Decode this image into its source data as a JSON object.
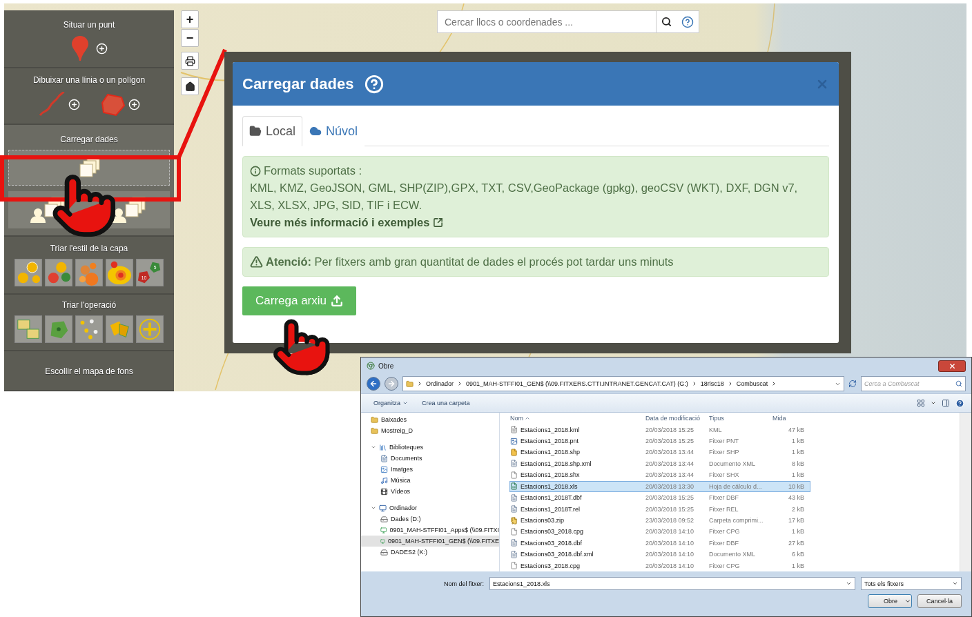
{
  "sidebar": {
    "sections": [
      {
        "kind": "point",
        "title": "Situar un punt"
      },
      {
        "kind": "draw",
        "title": "Dibuixar una línia o un polígon"
      },
      {
        "kind": "upload",
        "title": "Carregar dades"
      },
      {
        "kind": "styles",
        "title": "Triar l'estil de la capa",
        "cluster_counts": [
          "5",
          "10"
        ]
      },
      {
        "kind": "operations",
        "title": "Triar l'operació"
      },
      {
        "kind": "basemap",
        "title": "Escollir el mapa de fons"
      }
    ]
  },
  "map_controls": {
    "zoom_in": "+",
    "zoom_out": "−"
  },
  "search": {
    "placeholder": "Cercar llocs o coordenades ..."
  },
  "modal": {
    "title": "Carregar dades",
    "tabs": [
      {
        "kind": "local",
        "label": "Local",
        "selected": true
      },
      {
        "kind": "cloud",
        "label": "Núvol",
        "selected": false
      }
    ],
    "formats_title": "Formats suportats :",
    "formats": "KML, KMZ, GeoJSON, GML, SHP(ZIP),GPX, TXT, CSV,GeoPackage (gpkg), geoCSV (WKT), DXF, DGN v7, XLS, XLSX, JPG, SID, TIF i ECW.",
    "more_link": "Veure més informació i exemples",
    "warning": "**Atenció:** Per fitxers amb gran quantitat de dades el procés pot tardar uns minuts",
    "upload_button": "Carrega arxiu"
  },
  "file_dialog": {
    "title": "Obre",
    "path": [
      "Ordinador",
      "0901_MAH-STFFI01_GEN$ (\\\\09.FITXERS.CTTI.INTRANET.GENCAT.CAT) (G:)",
      "18risc18",
      "Combuscat"
    ],
    "search_placeholder": "Cerca a Combuscat",
    "toolbar": [
      "Organitza",
      "Crea una carpeta"
    ],
    "nav": [
      {
        "kind": "folder",
        "label": "Baixades",
        "selected": false
      },
      {
        "kind": "folder",
        "label": "Mostreig_D",
        "selected": false
      },
      {
        "kind": "library",
        "label": "Biblioteques",
        "selected": false,
        "expanded": true,
        "children": [
          {
            "kind": "doc",
            "label": "Documents",
            "selected": false
          },
          {
            "kind": "image",
            "label": "Imatges",
            "selected": false
          },
          {
            "kind": "music",
            "label": "Música",
            "selected": false
          },
          {
            "kind": "video",
            "label": "Vídeos",
            "selected": false
          }
        ]
      },
      {
        "kind": "computer",
        "label": "Ordinador",
        "selected": false,
        "expanded": true,
        "children": [
          {
            "kind": "drive",
            "label": "Dades (D:)",
            "selected": false
          },
          {
            "kind": "network",
            "label": "0901_MAH-STFFI01_Apps$ (\\\\09.FITXI",
            "selected": false
          },
          {
            "kind": "network",
            "label": "0901_MAH-STFFI01_GEN$ (\\\\09.FITXE",
            "selected": true
          },
          {
            "kind": "drive",
            "label": "DADES2 (K:)",
            "selected": false
          }
        ]
      }
    ],
    "columns": [
      "Nom",
      "Data de modificació",
      "Tipus",
      "Mida"
    ],
    "rows": [
      {
        "kind": "doc",
        "name": "Estacions1_2018.kml",
        "date": "20/03/2018 15:25",
        "type": "KML",
        "size": "47 kB",
        "selected": false
      },
      {
        "kind": "image",
        "name": "Estacions1_2018.pnt",
        "date": "20/03/2018 15:25",
        "type": "Fitxer PNT",
        "size": "1 kB",
        "selected": false
      },
      {
        "kind": "shape",
        "name": "Estacions1_2018.shp",
        "date": "20/03/2018 13:44",
        "type": "Fitxer SHP",
        "size": "1 kB",
        "selected": false
      },
      {
        "kind": "text",
        "name": "Estacions1_2018.shp.xml",
        "date": "20/03/2018 13:44",
        "type": "Documento XML",
        "size": "8 kB",
        "selected": false
      },
      {
        "kind": "blank",
        "name": "Estacions1_2018.shx",
        "date": "20/03/2018 13:44",
        "type": "Fitxer SHX",
        "size": "1 kB",
        "selected": false
      },
      {
        "kind": "sheet",
        "name": "Estacions1_2018.xls",
        "date": "20/03/2018 13:30",
        "type": "Hoja de cálculo d...",
        "size": "10 kB",
        "selected": true
      },
      {
        "kind": "text",
        "name": "Estacions1_2018T.dbf",
        "date": "20/03/2018 15:25",
        "type": "Fitxer DBF",
        "size": "43 kB",
        "selected": false
      },
      {
        "kind": "text",
        "name": "Estacions1_2018T.rel",
        "date": "20/03/2018 15:25",
        "type": "Fitxer REL",
        "size": "2 kB",
        "selected": false
      },
      {
        "kind": "zip",
        "name": "Estacions03.zip",
        "date": "23/03/2018 09:52",
        "type": "Carpeta comprimi...",
        "size": "17 kB",
        "selected": false
      },
      {
        "kind": "blank",
        "name": "Estacions03_2018.cpg",
        "date": "20/03/2018 14:10",
        "type": "Fitxer CPG",
        "size": "1 kB",
        "selected": false
      },
      {
        "kind": "text",
        "name": "Estacions03_2018.dbf",
        "date": "20/03/2018 14:10",
        "type": "Fitxer DBF",
        "size": "27 kB",
        "selected": false
      },
      {
        "kind": "text",
        "name": "Estacions03_2018.dbf.xml",
        "date": "20/03/2018 14:10",
        "type": "Documento XML",
        "size": "6 kB",
        "selected": false
      },
      {
        "kind": "blank",
        "name": "Estacions3_2018.cpg",
        "date": "20/03/2018 14:10",
        "type": "Fitxer CPG",
        "size": "1 kB",
        "selected": false
      }
    ],
    "filename_label": "Nom del fitxer:",
    "filename": "Estacions1_2018.xls",
    "filter": "Tots els fitxers",
    "buttons": [
      {
        "kind": "split",
        "label": "Obre"
      },
      {
        "kind": "plain",
        "label": "Cancel·la"
      }
    ]
  }
}
